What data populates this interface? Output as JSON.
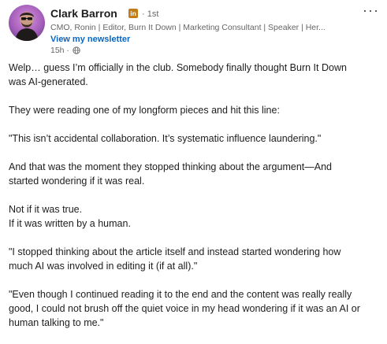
{
  "author": {
    "name": "Clark Barron",
    "badge": "in",
    "degree": "· 1st",
    "headline": "CMO, Ronin | Editor, Burn It Down | Marketing Consultant | Speaker | Her...",
    "newsletter_link": "View my newsletter",
    "timestamp": "15h ·"
  },
  "menu": {
    "more_label": "···"
  },
  "post": {
    "paragraphs": [
      [
        "Welp… guess I’m officially in the club. Somebody finally thought Burn It Down",
        "was AI-generated."
      ],
      [
        "They were reading one of my longform pieces and hit this line:"
      ],
      [
        "\"This isn’t accidental collaboration. It’s systematic influence laundering.\""
      ],
      [
        "And that was the moment they stopped thinking about the argument—And",
        "started wondering if it was real."
      ],
      [
        "Not if it was true.",
        "If it was written by a human."
      ],
      [
        "\"I stopped thinking about the article itself and instead started wondering how",
        "much AI was involved in editing it (if at all).\""
      ],
      [
        "\"Even though I continued reading it to the end and the content was really really",
        "good, I could not brush off the quiet voice in my head wondering if it was an AI or",
        "human talking to me.\""
      ]
    ]
  },
  "colors": {
    "link": "#0a66c2",
    "muted": "#666666",
    "badge": "#c37d16",
    "text": "#1d1d1d"
  },
  "icons": {
    "visibility": "globe-icon",
    "menu": "more-icon"
  }
}
